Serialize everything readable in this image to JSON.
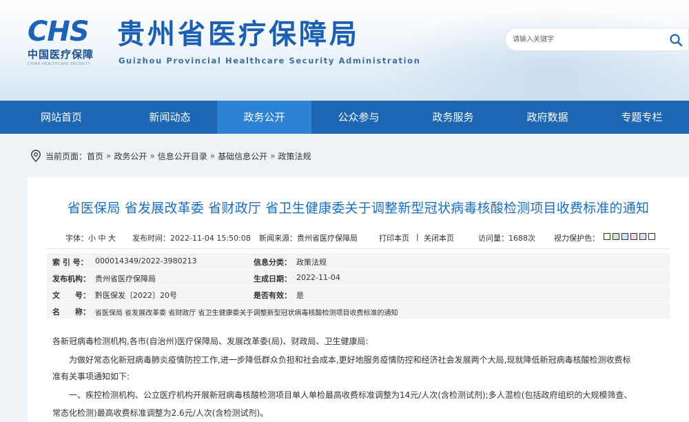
{
  "header": {
    "logo_mark": "CHS",
    "logo_cn": "中国医疗保障",
    "logo_en": "CHINA HEALTHCARE SECURITY",
    "title": "贵州省医疗保障局",
    "title_en": "Guizhou Provincial Healthcare Security Administration",
    "search_placeholder": "请输入关键字",
    "search_icon": "search-icon"
  },
  "nav": {
    "items": [
      "网站首页",
      "新闻动态",
      "政务公开",
      "公众参与",
      "政务服务",
      "政府数据",
      "专题专栏"
    ],
    "active": "政务公开"
  },
  "breadcrumb": {
    "prefix": "当前页面：",
    "items": [
      "首页",
      "政务公开",
      "信息公开目录",
      "基础信息公开",
      "政策法规"
    ],
    "separator": "»"
  },
  "article": {
    "title": "省医保局 省发展改革委 省财政厅 省卫生健康委关于调整新型冠状病毒核酸检测项目收费标准的通知",
    "meta": {
      "font_size": "字体：小 中 大",
      "publish_time": "发布时间：2022-11-04 15:50:08",
      "source": "新闻来源：贵州省医疗保障局",
      "print": "打印本页",
      "divider": "|",
      "close": "关闭本页",
      "visits": "访问量：1688次",
      "eye_care": "视力保护色：",
      "swatch_colors": [
        "#fffde0",
        "#cfe8cf",
        "#d0e4f7",
        "#f0d8e4",
        "#e8d9f2",
        "#ffffff"
      ]
    },
    "info": {
      "index_label": "索 引 号：",
      "index_value": "000014349/2022-3980213",
      "category_label": "信息分类：",
      "category_value": "政策法规",
      "publisher_label": "发布机构：",
      "publisher_value": "贵州省医疗保障局",
      "date_label": "生成日期：",
      "date_value": "2022-11-04",
      "doc_no_label": "文　　号：",
      "doc_no_value": "黔医保发〔2022〕20号",
      "valid_label": "是否有效：",
      "valid_value": "是",
      "name_label": "名　　称：",
      "name_value": "省医保局 省发展改革委 省财政厅 省卫生健康委关于调整新型冠状病毒核酸检测项目收费标准的通知"
    },
    "paragraphs": [
      "各新冠病毒检测机构,各市(自治州)医疗保障局、发展改革委(局)、财政局、卫生健康局:",
      "为做好常态化新冠病毒肺炎疫情防控工作,进一步降低群众负担和社会成本,更好地服务疫情防控和经济社会发展两个大局,现就降低新冠病毒核酸检测收费标",
      "准有关事项通知如下:",
      "一、疾控检测机构、公立医疗机构开展新冠病毒核酸检测项目单人单检最高收费标准调整为14元/人次(含检测试剂);多人混检(包括政府组织的大规模筛查、",
      "常态化检测)最高收费标准调整为2.6元/人次(含检测试剂)。"
    ]
  }
}
